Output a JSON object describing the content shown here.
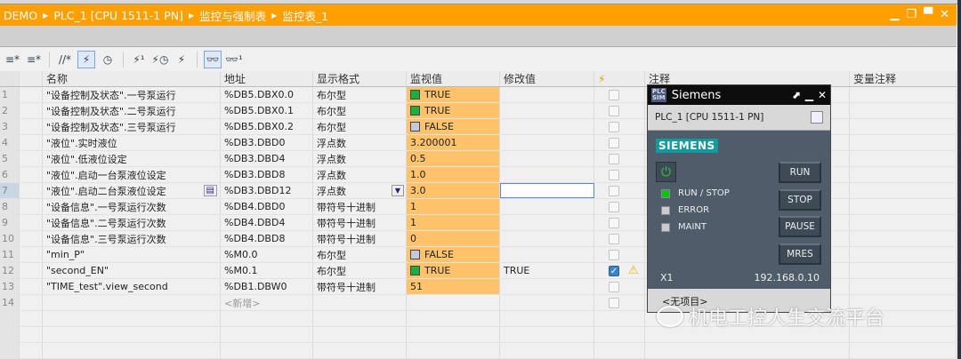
{
  "breadcrumb": [
    "DEMO",
    "PLC_1 [CPU 1511-1 PN]",
    "监控与强制表",
    "监控表_1"
  ],
  "window_controls": [
    "minimize-icon",
    "restore-icon",
    "maximize-icon",
    "close-icon"
  ],
  "toolbar": [
    "insert-row-icon",
    "add-row-icon",
    "insert-comment-row-icon",
    "show-force-columns-icon",
    "show-trigger-icon",
    "modify-now-icon",
    "modify-trigger-icon",
    "force-icon",
    "monitor-all-icon",
    "monitor-once-icon"
  ],
  "columns": [
    "名称",
    "地址",
    "显示格式",
    "监视值",
    "修改值",
    "",
    "注释",
    "变量注释"
  ],
  "rows": [
    {
      "n": "1",
      "name": "\"设备控制及状态\".一号泵运行",
      "addr": "%DB5.DBX0.0",
      "fmt": "布尔型",
      "mon": "TRUE",
      "bool": "on",
      "mod": "",
      "chk": false
    },
    {
      "n": "2",
      "name": "\"设备控制及状态\".二号泵运行",
      "addr": "%DB5.DBX0.1",
      "fmt": "布尔型",
      "mon": "TRUE",
      "bool": "on",
      "mod": "",
      "chk": false
    },
    {
      "n": "3",
      "name": "\"设备控制及状态\".三号泵运行",
      "addr": "%DB5.DBX0.2",
      "fmt": "布尔型",
      "mon": "FALSE",
      "bool": "off",
      "mod": "",
      "chk": false
    },
    {
      "n": "4",
      "name": "\"液位\".实时液位",
      "addr": "%DB3.DBD0",
      "fmt": "浮点数",
      "mon": "3.200001",
      "mod": "",
      "chk": false
    },
    {
      "n": "5",
      "name": "\"液位\".低液位设定",
      "addr": "%DB3.DBD4",
      "fmt": "浮点数",
      "mon": "0.5",
      "mod": "",
      "chk": false
    },
    {
      "n": "6",
      "name": "\"液位\".启动一台泵液位设定",
      "addr": "%DB3.DBD8",
      "fmt": "浮点数",
      "mon": "1.0",
      "mod": "",
      "chk": false
    },
    {
      "n": "7",
      "name": "\"液位\".启动二台泵液位设定",
      "addr": "%DB3.DBD12",
      "fmt": "浮点数",
      "mon": "3.0",
      "mod": "",
      "chk": false,
      "selected": true
    },
    {
      "n": "8",
      "name": "\"设备信息\".一号泵运行次数",
      "addr": "%DB4.DBD0",
      "fmt": "带符号十进制",
      "mon": "1",
      "mod": "",
      "chk": false
    },
    {
      "n": "9",
      "name": "\"设备信息\".二号泵运行次数",
      "addr": "%DB4.DBD4",
      "fmt": "带符号十进制",
      "mon": "1",
      "mod": "",
      "chk": false
    },
    {
      "n": "10",
      "name": "\"设备信息\".三号泵运行次数",
      "addr": "%DB4.DBD8",
      "fmt": "带符号十进制",
      "mon": "0",
      "mod": "",
      "chk": false
    },
    {
      "n": "11",
      "name": "\"min_P\"",
      "addr": "%M0.0",
      "fmt": "布尔型",
      "mon": "FALSE",
      "bool": "off",
      "mod": "",
      "chk": false
    },
    {
      "n": "12",
      "name": "\"second_EN\"",
      "addr": "%M0.1",
      "fmt": "布尔型",
      "mon": "TRUE",
      "bool": "on",
      "mod": "TRUE",
      "chk": true,
      "warn": true
    },
    {
      "n": "13",
      "name": "\"TIME_test\".view_second",
      "addr": "%DB1.DBW0",
      "fmt": "带符号十进制",
      "mon": "51",
      "mod": "",
      "chk": false
    },
    {
      "n": "14",
      "name": "",
      "addr": "<新增>",
      "fmt": "",
      "mon": "",
      "mod": "",
      "chk": false,
      "new": true
    }
  ],
  "sim": {
    "title": "Siemens",
    "logo": "PLC SIM",
    "device": "PLC_1 [CPU 1511-1 PN]",
    "brand": "SIEMENS",
    "leds": [
      {
        "label": "RUN / STOP",
        "color": "#10c010"
      },
      {
        "label": "ERROR",
        "color": "#cccccc"
      },
      {
        "label": "MAINT",
        "color": "#cccccc"
      }
    ],
    "buttons": [
      "RUN",
      "STOP",
      "PAUSE",
      "MRES"
    ],
    "port": "X1",
    "ip": "192.168.0.10",
    "project": "<无项目>"
  },
  "watermark": "机电工控人生交流平台",
  "colors": {
    "title": "#ff9f00",
    "monitor_bg": "#ffc36b",
    "sim_body": "#4f5c6a",
    "brand": "#129a9e"
  }
}
